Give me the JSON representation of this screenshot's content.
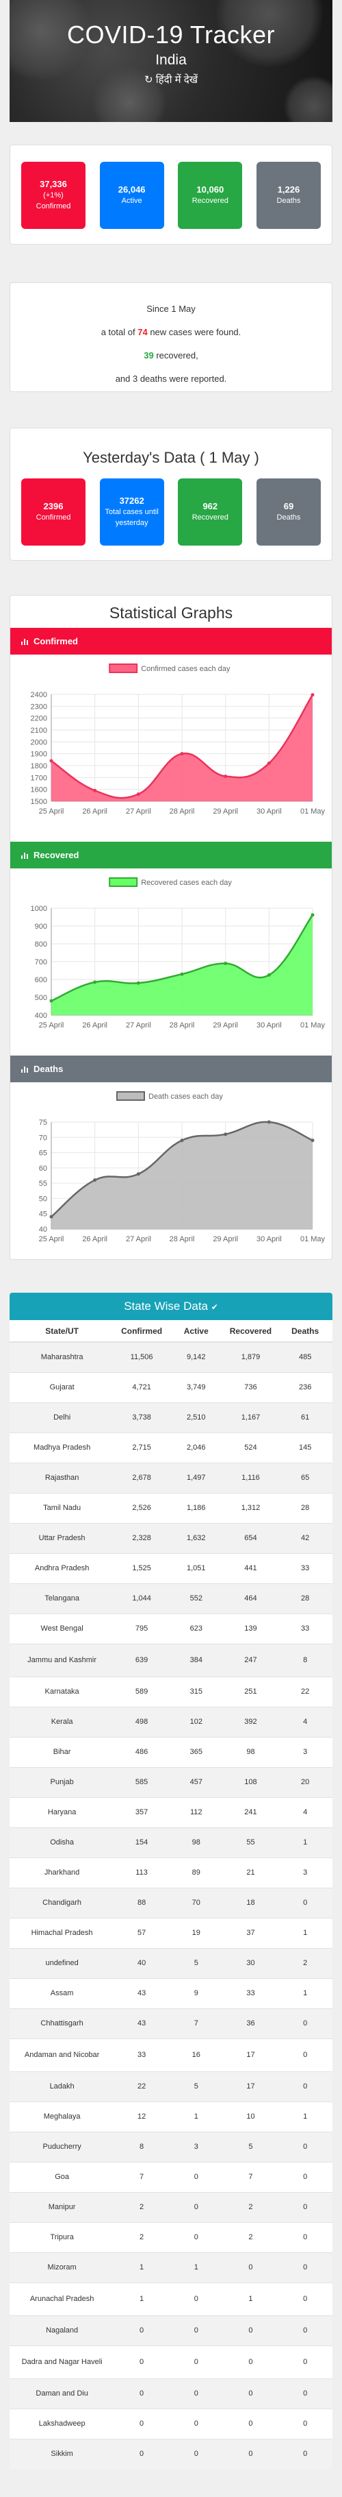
{
  "hero": {
    "title": "COVID-19 Tracker",
    "country": "India",
    "lang_toggle": "हिंदी में देखें"
  },
  "totals": [
    {
      "number": "37,336",
      "delta": "(+1%)",
      "label": "Confirmed",
      "color": "#f40f3b"
    },
    {
      "number": "26,046",
      "label": "Active",
      "color": "#007bff"
    },
    {
      "number": "10,060",
      "label": "Recovered",
      "color": "#28a745"
    },
    {
      "number": "1,226",
      "label": "Deaths",
      "color": "#6c757d"
    }
  ],
  "since": {
    "line1": "Since 1 May",
    "line2_pre": "a total of",
    "line2_num": "74",
    "line2_post": "new cases were found.",
    "line3_num": "39",
    "line3_post": "recovered,",
    "line4": "and 3 deaths were reported."
  },
  "yesterday": {
    "title": "Yesterday's Data ( 1 May )",
    "items": [
      {
        "number": "2396",
        "label": "Confirmed"
      },
      {
        "number": "37262",
        "label": "Total cases until yesterday"
      },
      {
        "number": "962",
        "label": "Recovered"
      },
      {
        "number": "69",
        "label": "Deaths"
      }
    ]
  },
  "graphs": {
    "title": "Statistical Graphs",
    "sections": [
      {
        "title": "Confirmed",
        "color": "#f40f3b"
      },
      {
        "title": "Recovered",
        "color": "#28a745"
      },
      {
        "title": "Deaths",
        "color": "#6c757d"
      }
    ]
  },
  "chart_data": [
    {
      "type": "area",
      "legend": "Confirmed cases each day",
      "x": [
        "25 April",
        "26 April",
        "27 April",
        "28 April",
        "29 April",
        "30 April",
        "01 May"
      ],
      "values": [
        1840,
        1590,
        1560,
        1900,
        1710,
        1820,
        2396
      ],
      "ylim": [
        1500,
        2400
      ],
      "yticks": [
        1500,
        1600,
        1700,
        1800,
        1900,
        2000,
        2100,
        2200,
        2300,
        2400
      ],
      "fill": "#ff6384",
      "stroke": "#e8345a",
      "legend_fill": "#ff6384",
      "legend_stroke": "#e8345a"
    },
    {
      "type": "area",
      "legend": "Recovered cases each day",
      "x": [
        "25 April",
        "26 April",
        "27 April",
        "28 April",
        "29 April",
        "30 April",
        "01 May"
      ],
      "values": [
        480,
        585,
        580,
        630,
        690,
        625,
        962
      ],
      "ylim": [
        400,
        1000
      ],
      "yticks": [
        400,
        500,
        600,
        700,
        800,
        900,
        1000
      ],
      "fill": "#66ff66",
      "stroke": "#33aa33",
      "legend_fill": "#66ff66",
      "legend_stroke": "#33aa33"
    },
    {
      "type": "area",
      "legend": "Death cases each day",
      "x": [
        "25 April",
        "26 April",
        "27 April",
        "28 April",
        "29 April",
        "30 April",
        "01 May"
      ],
      "values": [
        44,
        56,
        58,
        69,
        71,
        75,
        69
      ],
      "ylim": [
        40,
        75
      ],
      "yticks": [
        40,
        45,
        50,
        55,
        60,
        65,
        70,
        75
      ],
      "fill": "#bdbdbd",
      "stroke": "#666666",
      "legend_fill": "#bdbdbd",
      "legend_stroke": "#666666"
    }
  ],
  "state_table": {
    "title": "State Wise Data",
    "headers": [
      "State/UT",
      "Confirmed",
      "Active",
      "Recovered",
      "Deaths"
    ],
    "rows": [
      [
        "Maharashtra",
        "11,506",
        "9,142",
        "1,879",
        "485"
      ],
      [
        "Gujarat",
        "4,721",
        "3,749",
        "736",
        "236"
      ],
      [
        "Delhi",
        "3,738",
        "2,510",
        "1,167",
        "61"
      ],
      [
        "Madhya Pradesh",
        "2,715",
        "2,046",
        "524",
        "145"
      ],
      [
        "Rajasthan",
        "2,678",
        "1,497",
        "1,116",
        "65"
      ],
      [
        "Tamil Nadu",
        "2,526",
        "1,186",
        "1,312",
        "28"
      ],
      [
        "Uttar Pradesh",
        "2,328",
        "1,632",
        "654",
        "42"
      ],
      [
        "Andhra Pradesh",
        "1,525",
        "1,051",
        "441",
        "33"
      ],
      [
        "Telangana",
        "1,044",
        "552",
        "464",
        "28"
      ],
      [
        "West Bengal",
        "795",
        "623",
        "139",
        "33"
      ],
      [
        "Jammu and Kashmir",
        "639",
        "384",
        "247",
        "8"
      ],
      [
        "Karnataka",
        "589",
        "315",
        "251",
        "22"
      ],
      [
        "Kerala",
        "498",
        "102",
        "392",
        "4"
      ],
      [
        "Bihar",
        "486",
        "365",
        "98",
        "3"
      ],
      [
        "Punjab",
        "585",
        "457",
        "108",
        "20"
      ],
      [
        "Haryana",
        "357",
        "112",
        "241",
        "4"
      ],
      [
        "Odisha",
        "154",
        "98",
        "55",
        "1"
      ],
      [
        "Jharkhand",
        "113",
        "89",
        "21",
        "3"
      ],
      [
        "Chandigarh",
        "88",
        "70",
        "18",
        "0"
      ],
      [
        "Himachal Pradesh",
        "57",
        "19",
        "37",
        "1"
      ],
      [
        "undefined",
        "40",
        "5",
        "30",
        "2"
      ],
      [
        "Assam",
        "43",
        "9",
        "33",
        "1"
      ],
      [
        "Chhattisgarh",
        "43",
        "7",
        "36",
        "0"
      ],
      [
        "Andaman and Nicobar",
        "33",
        "16",
        "17",
        "0"
      ],
      [
        "Ladakh",
        "22",
        "5",
        "17",
        "0"
      ],
      [
        "Meghalaya",
        "12",
        "1",
        "10",
        "1"
      ],
      [
        "Puducherry",
        "8",
        "3",
        "5",
        "0"
      ],
      [
        "Goa",
        "7",
        "0",
        "7",
        "0"
      ],
      [
        "Manipur",
        "2",
        "0",
        "2",
        "0"
      ],
      [
        "Tripura",
        "2",
        "0",
        "2",
        "0"
      ],
      [
        "Mizoram",
        "1",
        "1",
        "0",
        "0"
      ],
      [
        "Arunachal Pradesh",
        "1",
        "0",
        "1",
        "0"
      ],
      [
        "Nagaland",
        "0",
        "0",
        "0",
        "0"
      ],
      [
        "Dadra and Nagar Haveli",
        "0",
        "0",
        "0",
        "0"
      ],
      [
        "Daman and Diu",
        "0",
        "0",
        "0",
        "0"
      ],
      [
        "Lakshadweep",
        "0",
        "0",
        "0",
        "0"
      ],
      [
        "Sikkim",
        "0",
        "0",
        "0",
        "0"
      ]
    ]
  }
}
